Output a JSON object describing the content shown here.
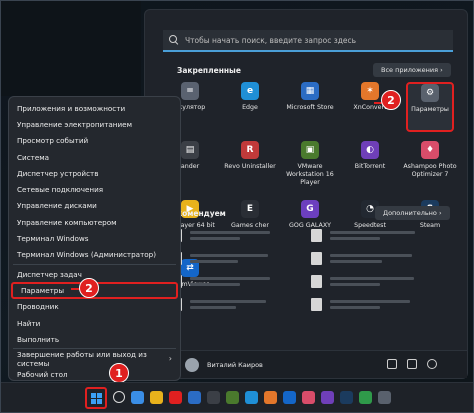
{
  "start_menu": {
    "search_placeholder": "Чтобы начать поиск, введите запрос здесь",
    "pinned_title": "Закрепленные",
    "all_apps_button": "Все приложения  ›",
    "recommended_title": "комендуем",
    "more_button": "Дополнительно  ›",
    "user_name": "Виталий Каиров",
    "apps": [
      {
        "label": "ькулятор",
        "color": "#5a6270",
        "glyph": "="
      },
      {
        "label": "Edge",
        "color": "#1f8fd6",
        "glyph": "e"
      },
      {
        "label": "Microsoft Store",
        "color": "#2b6cc4",
        "glyph": "▦"
      },
      {
        "label": "XnConvert",
        "color": "#e3772b",
        "glyph": "✶"
      },
      {
        "label": "Параметры",
        "color": "#59616d",
        "glyph": "⚙"
      },
      {
        "label": "ander",
        "color": "#3b3f46",
        "glyph": "▤"
      },
      {
        "label": "Revo Uninstaller",
        "color": "#c13a3a",
        "glyph": "R"
      },
      {
        "label": "VMware Workstation 16 Player",
        "color": "#4a7a2d",
        "glyph": "▣"
      },
      {
        "label": "BitTorrent",
        "color": "#6f3fb8",
        "glyph": "◐"
      },
      {
        "label": "Ashampoo Photo Optimizer 7",
        "color": "#d84d6a",
        "glyph": "♦"
      },
      {
        "label": "PotPlayer 64 bit",
        "color": "#e8b21c",
        "glyph": "▶"
      },
      {
        "label": "Games cher",
        "color": "#2a2e35",
        "glyph": "E"
      },
      {
        "label": "GOG GALAXY",
        "color": "#6c3fbf",
        "glyph": "G"
      },
      {
        "label": "Speedtest",
        "color": "#222831",
        "glyph": "◔"
      },
      {
        "label": "Steam",
        "color": "#1b3b5e",
        "glyph": "S"
      },
      {
        "label": "TeamViewer",
        "color": "#1466c8",
        "glyph": "⇄"
      }
    ]
  },
  "context_menu": {
    "items": [
      {
        "label": "Приложения и возможности"
      },
      {
        "label": "Управление электропитанием"
      },
      {
        "label": "Просмотр событий"
      },
      {
        "label": "Система"
      },
      {
        "label": "Диспетчер устройств"
      },
      {
        "label": "Сетевые подключения"
      },
      {
        "label": "Управление дисками"
      },
      {
        "label": "Управление компьютером"
      },
      {
        "label": "Терминал Windows"
      },
      {
        "label": "Терминал Windows (Администратор)"
      },
      {
        "label": "Диспетчер задач"
      },
      {
        "label": "Параметры"
      },
      {
        "label": "Проводник"
      },
      {
        "label": "Найти"
      },
      {
        "label": "Выполнить"
      },
      {
        "label": "Завершение работы или выход из системы"
      },
      {
        "label": "Рабочий стол"
      }
    ],
    "submenu_chevron": "›"
  },
  "badges": {
    "one": "1",
    "two_menu": "2",
    "two_start": "2"
  },
  "taskbar_colors": [
    "#3a8ee6",
    "#e8b21c",
    "#e02020",
    "#2b6cc4",
    "#3b3f46",
    "#4a7a2d",
    "#1f8fd6",
    "#e3772b",
    "#1466c8",
    "#d84d6a",
    "#6f3fb8",
    "#1b3b5e",
    "#2f9a4a",
    "#59616d"
  ]
}
